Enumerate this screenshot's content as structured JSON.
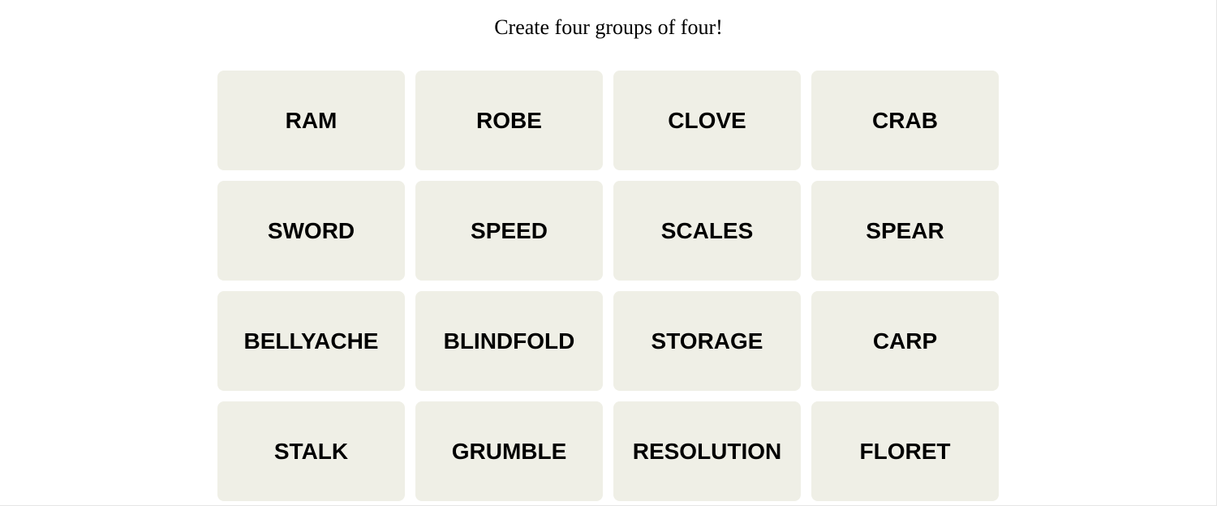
{
  "instructions": "Create four groups of four!",
  "tiles": [
    "RAM",
    "ROBE",
    "CLOVE",
    "CRAB",
    "SWORD",
    "SPEED",
    "SCALES",
    "SPEAR",
    "BELLYACHE",
    "BLINDFOLD",
    "STORAGE",
    "CARP",
    "STALK",
    "GRUMBLE",
    "RESOLUTION",
    "FLORET"
  ],
  "colors": {
    "tile_bg": "#efefe6",
    "text": "#000000"
  }
}
